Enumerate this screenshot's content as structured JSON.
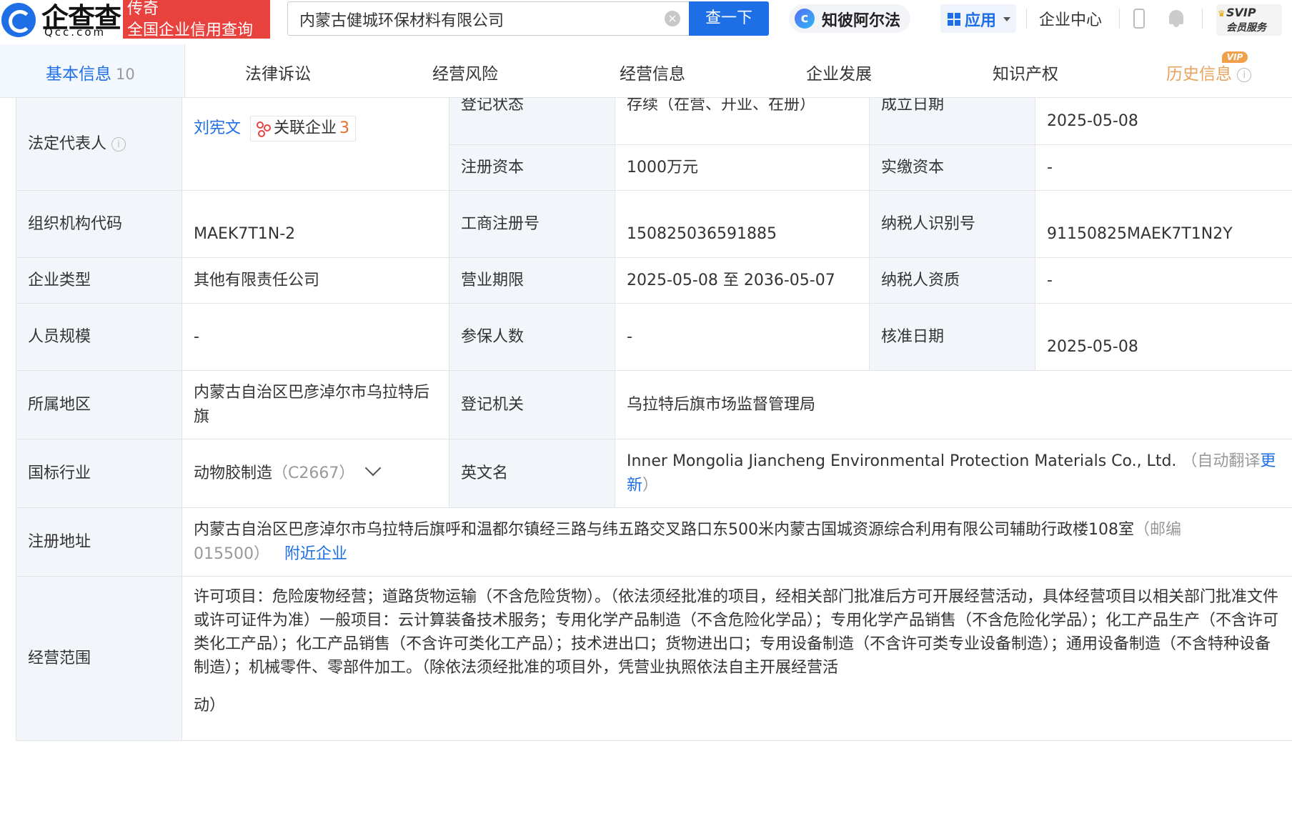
{
  "header": {
    "logo_text": "企查查",
    "logo_sub": "Qcc.com",
    "slogan_line1": "传奇",
    "slogan_line2": "全国企业信用查询",
    "search_value": "内蒙古健城环保材料有限公司",
    "search_button": "查一下",
    "zhibi_label": "知彼阿尔法",
    "apps_label": "应用",
    "enterprise_center": "企业中心",
    "svip_line1": "SVIP",
    "svip_line2": "会员服务",
    "colors": {
      "primary": "#1e6fe6",
      "slogan_bg": "#e8423f",
      "vip": "#f0a04a"
    }
  },
  "tabs": [
    {
      "label": "基本信息",
      "count": "10"
    },
    {
      "label": "法律诉讼"
    },
    {
      "label": "经营风险"
    },
    {
      "label": "经营信息"
    },
    {
      "label": "企业发展"
    },
    {
      "label": "知识产权"
    },
    {
      "label": "历史信息",
      "badge": "VIP"
    }
  ],
  "info": {
    "legal_rep_label": "法定代表人",
    "legal_rep_name": "刘宪文",
    "assoc_label": "关联企业",
    "assoc_count": "3",
    "reg_status_label": "登记状态",
    "reg_status": "存续（在营、开业、在册）",
    "founded_label": "成立日期",
    "founded": "2025-05-08",
    "reg_capital_label": "注册资本",
    "reg_capital": "1000万元",
    "paid_capital_label": "实缴资本",
    "paid_capital": "-",
    "org_code_label": "组织机构代码",
    "org_code": "MAEK7T1N-2",
    "biz_reg_no_label": "工商注册号",
    "biz_reg_no": "150825036591885",
    "taxpayer_id_label": "纳税人识别号",
    "taxpayer_id": "91150825MAEK7T1N2Y",
    "company_type_label": "企业类型",
    "company_type": "其他有限责任公司",
    "biz_term_label": "营业期限",
    "biz_term": "2025-05-08 至 2036-05-07",
    "taxpayer_qual_label": "纳税人资质",
    "taxpayer_qual": "-",
    "staff_size_label": "人员规模",
    "staff_size": "-",
    "insured_label": "参保人数",
    "insured": "-",
    "approval_date_label": "核准日期",
    "approval_date": "2025-05-08",
    "region_label": "所属地区",
    "region": "内蒙古自治区巴彦淖尔市乌拉特后旗",
    "reg_authority_label": "登记机关",
    "reg_authority": "乌拉特后旗市场监督管理局",
    "industry_label": "国标行业",
    "industry": "动物胶制造",
    "industry_code": "（C2667）",
    "english_name_label": "英文名",
    "english_name": "Inner Mongolia Jiancheng Environmental Protection Materials Co., Ltd.",
    "english_auto_prefix": "（自动翻译",
    "english_update": "更新",
    "english_auto_suffix": "）",
    "address_label": "注册地址",
    "address": "内蒙古自治区巴彦淖尔市乌拉特后旗呼和温都尔镇经三路与纬五路交叉路口东500米内蒙古国城资源综合利用有限公司辅助行政楼108室",
    "postcode": "（邮编015500）",
    "nearby": "附近企业",
    "scope_label": "经营范围",
    "scope": "许可项目：危险废物经营；道路货物运输（不含危险货物）。（依法须经批准的项目，经相关部门批准后方可开展经营活动，具体经营项目以相关部门批准文件或许可证件为准）一般项目：云计算装备技术服务；专用化学产品制造（不含危险化学品）；专用化学产品销售（不含危险化学品）；化工产品生产（不含许可类化工产品）；化工产品销售（不含许可类化工产品）；技术进出口；货物进出口；专用设备制造（不含许可类专业设备制造）；通用设备制造（不含特种设备制造）；机械零件、零部件加工。（除依法须经批准的项目外，凭营业执照依法自主开展经营活",
    "scope_tail": "动）"
  }
}
